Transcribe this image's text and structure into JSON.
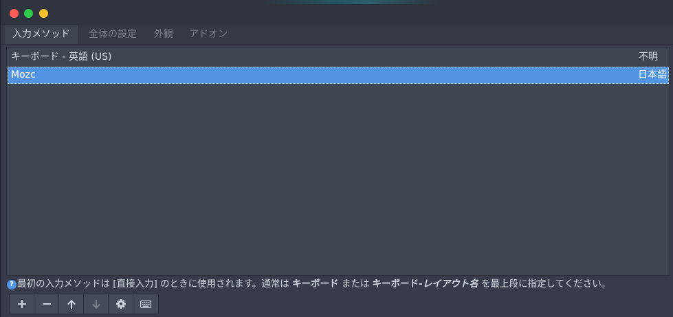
{
  "tabs": [
    {
      "label": "入力メソッド",
      "active": true
    },
    {
      "label": "全体の設定",
      "active": false
    },
    {
      "label": "外観",
      "active": false
    },
    {
      "label": "アドオン",
      "active": false
    }
  ],
  "input_methods": [
    {
      "name": "キーボード - 英語 (US)",
      "language": "不明",
      "selected": false
    },
    {
      "name": "Mozc",
      "language": "日本語",
      "selected": true
    }
  ],
  "hint": {
    "icon": "?",
    "part1": "最初の入力メソッドは [直接入力] のときに使用されます。通常は ",
    "bold1": "キーボード",
    "part2": " または ",
    "bold2": "キーボード-",
    "bold3": "レイアウト名",
    "part3": " を最上段に指定してください。"
  },
  "toolbar": {
    "buttons": [
      {
        "icon": "plus-icon",
        "enabled": true
      },
      {
        "icon": "minus-icon",
        "enabled": true
      },
      {
        "icon": "arrow-up-icon",
        "enabled": true
      },
      {
        "icon": "arrow-down-icon",
        "enabled": false
      },
      {
        "icon": "gear-icon",
        "enabled": true
      },
      {
        "icon": "keyboard-icon",
        "enabled": true
      }
    ]
  },
  "colors": {
    "window_bg": "#383c4a",
    "list_bg": "#404552",
    "selection": "#5294e2",
    "text": "#d3dae3",
    "text_dim": "#7c818c",
    "close": "#fc5b57",
    "maximize": "#2ec84a",
    "minimize": "#f5c22c"
  }
}
